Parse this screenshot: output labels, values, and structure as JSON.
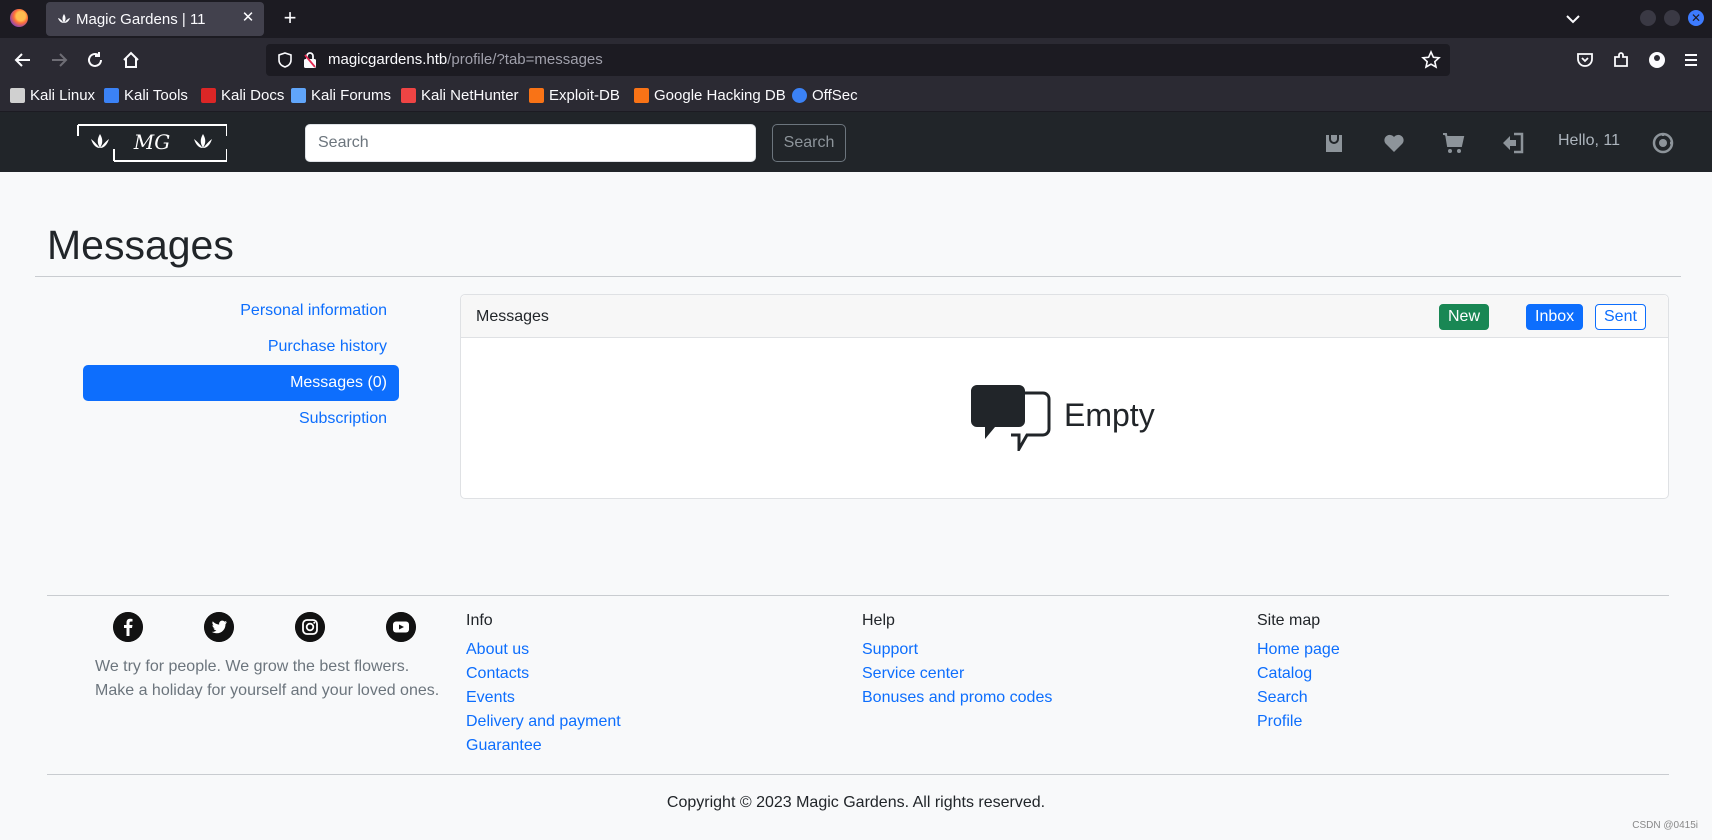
{
  "browser": {
    "tab_title": "Magic Gardens | 11",
    "url_host": "magicgardens.htb",
    "url_path": "/profile/?tab=messages",
    "bookmarks": [
      {
        "label": "Kali Linux",
        "color": "#d0d0d0"
      },
      {
        "label": "Kali Tools",
        "color": "#3b82f6"
      },
      {
        "label": "Kali Docs",
        "color": "#dc2626"
      },
      {
        "label": "Kali Forums",
        "color": "#60a5fa"
      },
      {
        "label": "Kali NetHunter",
        "color": "#ef4444"
      },
      {
        "label": "Exploit-DB",
        "color": "#f97316"
      },
      {
        "label": "Google Hacking DB",
        "color": "#f97316"
      },
      {
        "label": "OffSec",
        "color": "#3b82f6"
      }
    ]
  },
  "header": {
    "logo_text": "MG",
    "search_placeholder": "Search",
    "search_button": "Search",
    "greeting": "Hello, 11"
  },
  "page": {
    "title": "Messages",
    "sidebar": [
      {
        "label": "Personal information",
        "active": false
      },
      {
        "label": "Purchase history",
        "active": false
      },
      {
        "label": "Messages (0)",
        "active": true
      },
      {
        "label": "Subscription",
        "active": false
      }
    ],
    "card": {
      "title": "Messages",
      "new_label": "New",
      "inbox_label": "Inbox",
      "sent_label": "Sent",
      "empty_text": "Empty"
    }
  },
  "footer": {
    "tagline_line1": "We try for people. We grow the best flowers.",
    "tagline_line2": "Make a holiday for yourself and your loved ones.",
    "columns": [
      {
        "heading": "Info",
        "links": [
          "About us",
          "Contacts",
          "Events",
          "Delivery and payment",
          "Guarantee"
        ]
      },
      {
        "heading": "Help",
        "links": [
          "Support",
          "Service center",
          "Bonuses and promo codes"
        ]
      },
      {
        "heading": "Site map",
        "links": [
          "Home page",
          "Catalog",
          "Search",
          "Profile"
        ]
      }
    ],
    "copyright": "Copyright © 2023 Magic Gardens. All rights reserved.",
    "watermark": "CSDN @0415i"
  },
  "colors": {
    "primary": "#0d6efd",
    "success": "#198754",
    "dark": "#212529"
  }
}
